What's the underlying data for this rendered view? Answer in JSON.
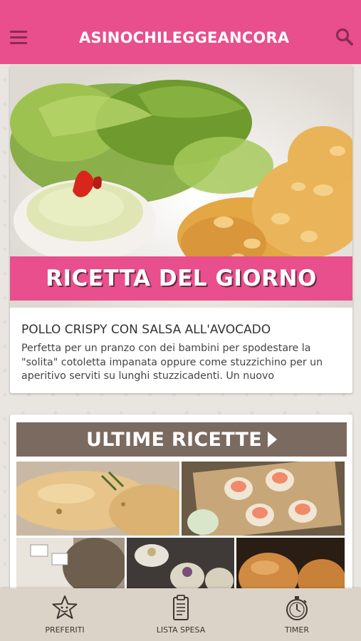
{
  "header": {
    "brand": "ASINOCHILEGGEANCORA",
    "menu_icon": "hamburger-menu-icon",
    "search_icon": "search-icon",
    "color": "#e84f8c"
  },
  "featured": {
    "banner": "RICETTA DEL GIORNO",
    "title": "POLLO CRISPY CON SALSA ALL'AVOCADO",
    "description": "Perfetta per un pranzo con dei bambini per spodestare la \"solita\" cotoletta impanata oppure come stuzzichino per un aperitivo serviti su lunghi stuzzicadenti. Un nuovo"
  },
  "latest": {
    "header": "ULTIME RICETTE",
    "arrow_icon": "play-arrow-icon"
  },
  "bottom_nav": {
    "items": [
      {
        "label": "PREFERITI",
        "icon": "star-favorite-icon"
      },
      {
        "label": "LISTA SPESA",
        "icon": "shopping-list-icon"
      },
      {
        "label": "TIMER",
        "icon": "stopwatch-timer-icon"
      }
    ]
  }
}
